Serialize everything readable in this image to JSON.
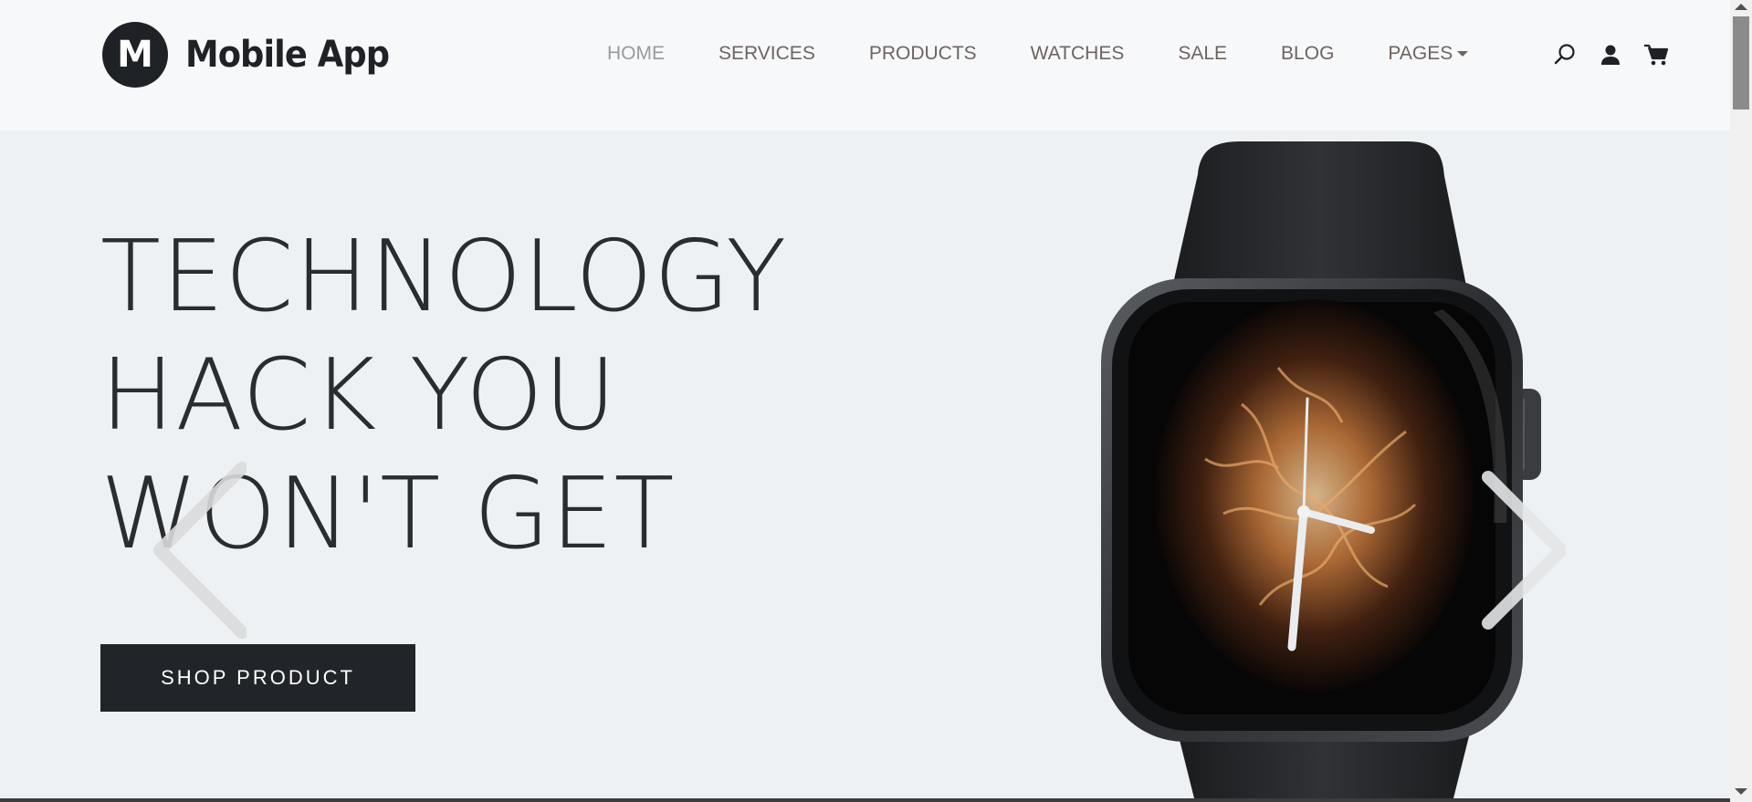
{
  "brand": {
    "mark": "M",
    "name": "Mobile App"
  },
  "nav": {
    "items": [
      {
        "label": "HOME",
        "active": true
      },
      {
        "label": "SERVICES"
      },
      {
        "label": "PRODUCTS"
      },
      {
        "label": "WATCHES"
      },
      {
        "label": "SALE"
      },
      {
        "label": "BLOG"
      },
      {
        "label": "PAGES",
        "has_dropdown": true
      }
    ]
  },
  "header_icons": [
    "search-icon",
    "user-icon",
    "cart-icon"
  ],
  "hero": {
    "headline_lines": [
      "TECHNOLOGY",
      "HACK YOU",
      "WON'T GET"
    ],
    "cta_label": "SHOP PRODUCT"
  },
  "colors": {
    "hero_bg": "#edf1f3",
    "header_bg": "#f7f8fa",
    "button_bg": "#212529",
    "nav_text": "#6e6460",
    "nav_active": "#9a9a9a"
  }
}
